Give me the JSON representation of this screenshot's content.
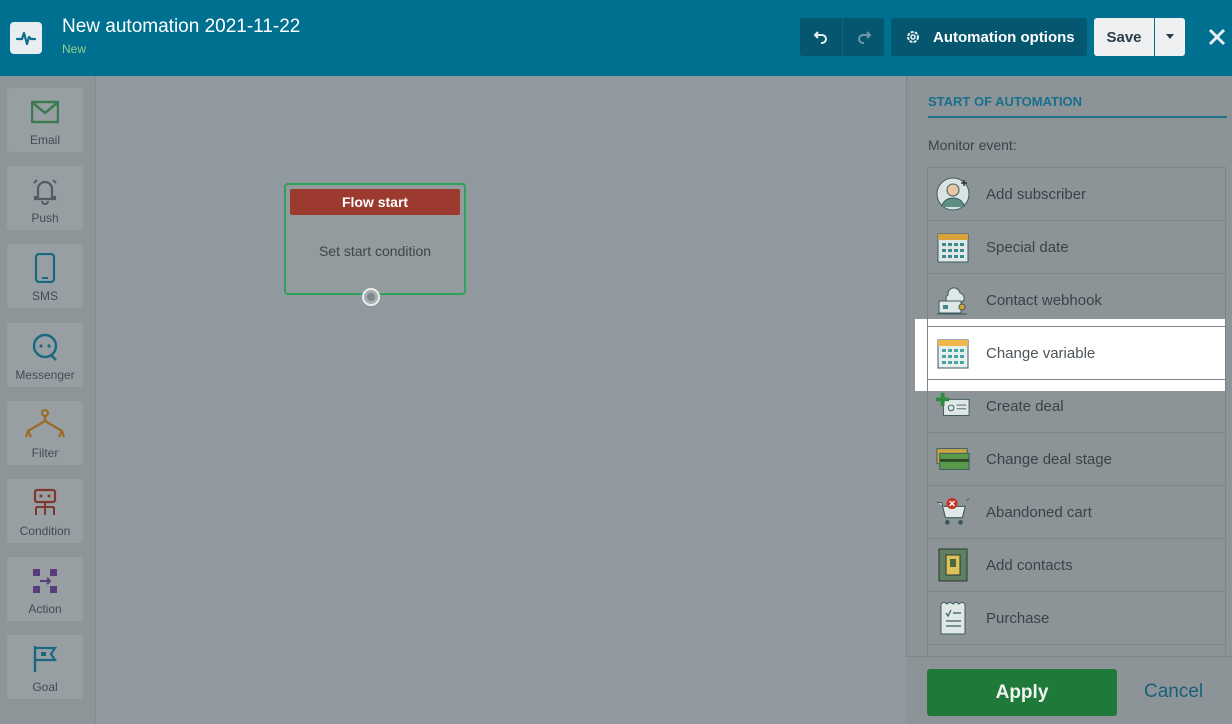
{
  "header": {
    "title": "New automation 2021-11-22",
    "status": "New",
    "options_label": "Automation options",
    "save_label": "Save"
  },
  "toolbar": {
    "items": [
      {
        "label": "Email",
        "icon": "envelope-icon"
      },
      {
        "label": "Push",
        "icon": "bell-icon"
      },
      {
        "label": "SMS",
        "icon": "phone-icon"
      },
      {
        "label": "Messenger",
        "icon": "chat-icon"
      },
      {
        "label": "Filter",
        "icon": "filter-icon"
      },
      {
        "label": "Condition",
        "icon": "condition-icon"
      },
      {
        "label": "Action",
        "icon": "action-icon"
      },
      {
        "label": "Goal",
        "icon": "flag-icon"
      }
    ]
  },
  "canvas": {
    "node_title": "Flow start",
    "node_body": "Set start condition"
  },
  "panel": {
    "title": "START OF AUTOMATION",
    "monitor_label": "Monitor event:",
    "events": [
      {
        "label": "Add subscriber"
      },
      {
        "label": "Special date"
      },
      {
        "label": "Contact webhook"
      },
      {
        "label": "Change variable"
      },
      {
        "label": "Create deal"
      },
      {
        "label": "Change deal stage"
      },
      {
        "label": "Abandoned cart"
      },
      {
        "label": "Add contacts"
      },
      {
        "label": "Purchase"
      }
    ],
    "highlighted": "Change variable",
    "apply_label": "Apply",
    "cancel_label": "Cancel"
  },
  "colors": {
    "header_bg": "#007090",
    "accent_green": "#2ea15a",
    "node_head_red": "#9c3a30"
  }
}
